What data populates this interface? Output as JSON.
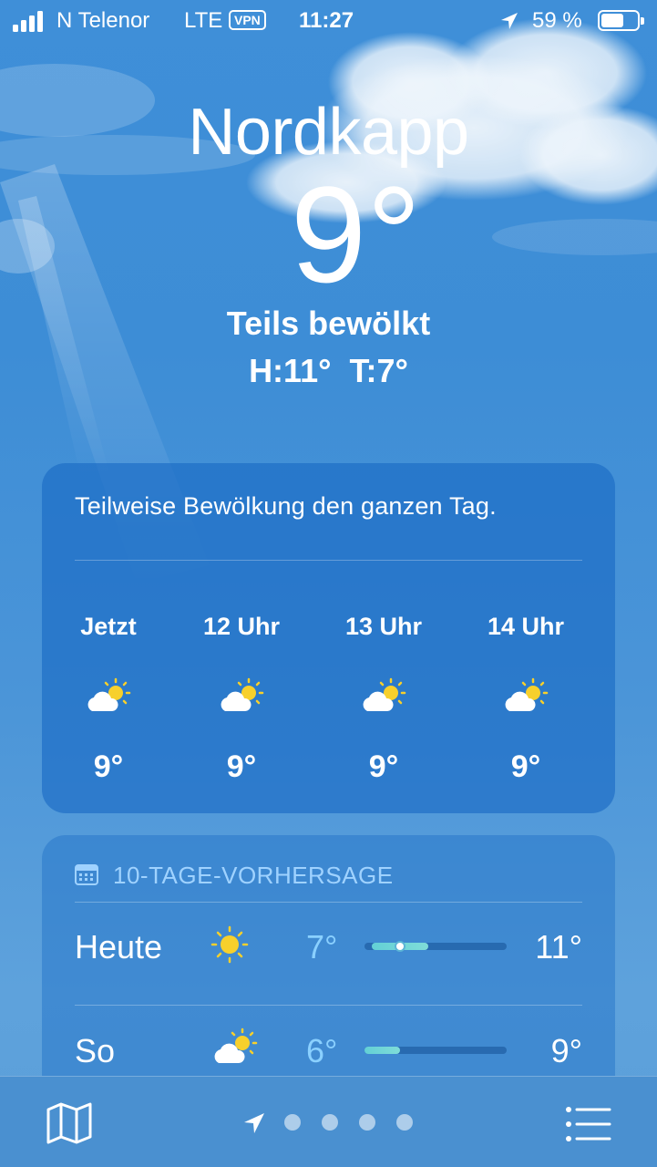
{
  "status_bar": {
    "carrier": "N Telenor",
    "network": "LTE",
    "vpn": "VPN",
    "time": "11:27",
    "battery": "59 %"
  },
  "header": {
    "city": "Nordkapp",
    "temperature": "9°",
    "condition": "Teils bewölkt",
    "high_low": "H:11° T:7°"
  },
  "hourly_card": {
    "summary": "Teilweise Bewölkung den ganzen Tag.",
    "hours": [
      {
        "label": "Jetzt",
        "icon": "partly-cloudy-icon",
        "temp": "9°"
      },
      {
        "label": "12 Uhr",
        "icon": "partly-cloudy-icon",
        "temp": "9°"
      },
      {
        "label": "13 Uhr",
        "icon": "partly-cloudy-icon",
        "temp": "9°"
      },
      {
        "label": "14 Uhr",
        "icon": "partly-cloudy-icon",
        "temp": "9°"
      }
    ]
  },
  "forecast_card": {
    "title": "10-TAGE-VORHERSAGE",
    "icon": "calendar-icon",
    "days": [
      {
        "day": "Heute",
        "icon": "sun-icon",
        "low": "7°",
        "high": "11°",
        "range_start": 0.05,
        "range_end": 0.45,
        "current": 0.25
      },
      {
        "day": "So",
        "icon": "partly-cloudy-icon",
        "low": "6°",
        "high": "9°",
        "range_start": 0.0,
        "range_end": 0.25
      }
    ]
  },
  "toolbar": {
    "map_icon": "map-icon",
    "location_icon": "location-arrow-icon",
    "page_dots": 4,
    "list_icon": "list-icon"
  },
  "colors": {
    "sky": "#3f8fd8",
    "card": "#1869c3",
    "sun": "#f7d02c",
    "range_bar": "#63d0d6",
    "low_temp": "#8ad0ff"
  }
}
